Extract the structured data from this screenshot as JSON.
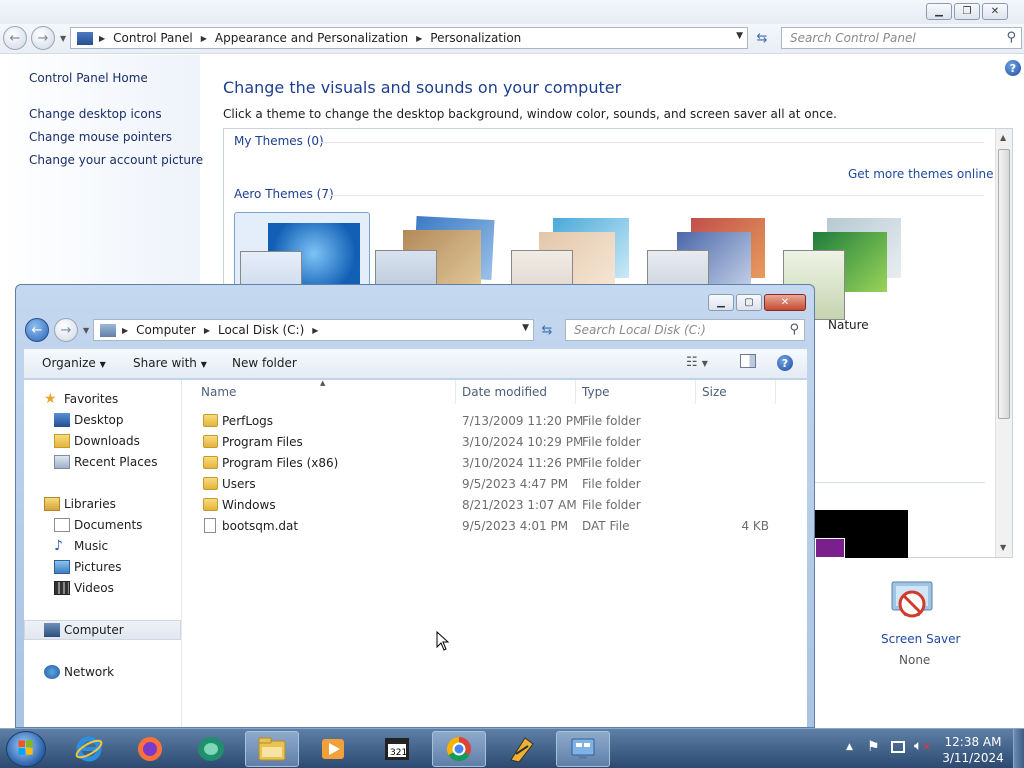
{
  "control_panel": {
    "breadcrumb": [
      "Control Panel",
      "Appearance and Personalization",
      "Personalization"
    ],
    "search_placeholder": "Search Control Panel",
    "left_links": [
      "Control Panel Home",
      "Change desktop icons",
      "Change mouse pointers",
      "Change your account picture"
    ],
    "title": "Change the visuals and sounds on your computer",
    "subtitle": "Click a theme to change the desktop background, window color, sounds, and screen saver all at once.",
    "my_themes": "My Themes (0)",
    "get_more_themes": "Get more themes online",
    "aero_themes": "Aero Themes (7)",
    "visible_theme_label": "Nature",
    "screen_saver_label": "Screen Saver",
    "screen_saver_value": "None"
  },
  "explorer": {
    "breadcrumb": [
      "Computer",
      "Local Disk (C:)"
    ],
    "search_placeholder": "Search Local Disk (C:)",
    "toolbar": {
      "organize": "Organize",
      "share_with": "Share with",
      "new_folder": "New folder"
    },
    "nav": {
      "favorites": "Favorites",
      "favorites_items": [
        "Desktop",
        "Downloads",
        "Recent Places"
      ],
      "libraries": "Libraries",
      "libraries_items": [
        "Documents",
        "Music",
        "Pictures",
        "Videos"
      ],
      "computer": "Computer",
      "network": "Network"
    },
    "columns": [
      "Name",
      "Date modified",
      "Type",
      "Size"
    ],
    "files": [
      {
        "name": "PerfLogs",
        "date": "7/13/2009 11:20 PM",
        "type": "File folder",
        "size": "",
        "kind": "folder"
      },
      {
        "name": "Program Files",
        "date": "3/10/2024 10:29 PM",
        "type": "File folder",
        "size": "",
        "kind": "folder"
      },
      {
        "name": "Program Files (x86)",
        "date": "3/10/2024 11:26 PM",
        "type": "File folder",
        "size": "",
        "kind": "folder"
      },
      {
        "name": "Users",
        "date": "9/5/2023 4:47 PM",
        "type": "File folder",
        "size": "",
        "kind": "folder"
      },
      {
        "name": "Windows",
        "date": "8/21/2023 1:07 AM",
        "type": "File folder",
        "size": "",
        "kind": "folder"
      },
      {
        "name": "bootsqm.dat",
        "date": "9/5/2023 4:01 PM",
        "type": "DAT File",
        "size": "4 KB",
        "kind": "file"
      }
    ]
  },
  "taskbar": {
    "apps": [
      "internet-explorer-icon",
      "firefox-icon",
      "app-icon",
      "file-explorer-icon",
      "media-player-icon",
      "media-player-classic-icon",
      "chrome-icon",
      "app-icon",
      "remote-desktop-icon"
    ],
    "time": "12:38 AM",
    "date": "3/11/2024"
  },
  "colors": {
    "link_blue": "#1e3f8f",
    "taskbar_top": "#5e7fa6",
    "taskbar_bottom": "#2c4a70",
    "close_red": "#c64b32"
  }
}
